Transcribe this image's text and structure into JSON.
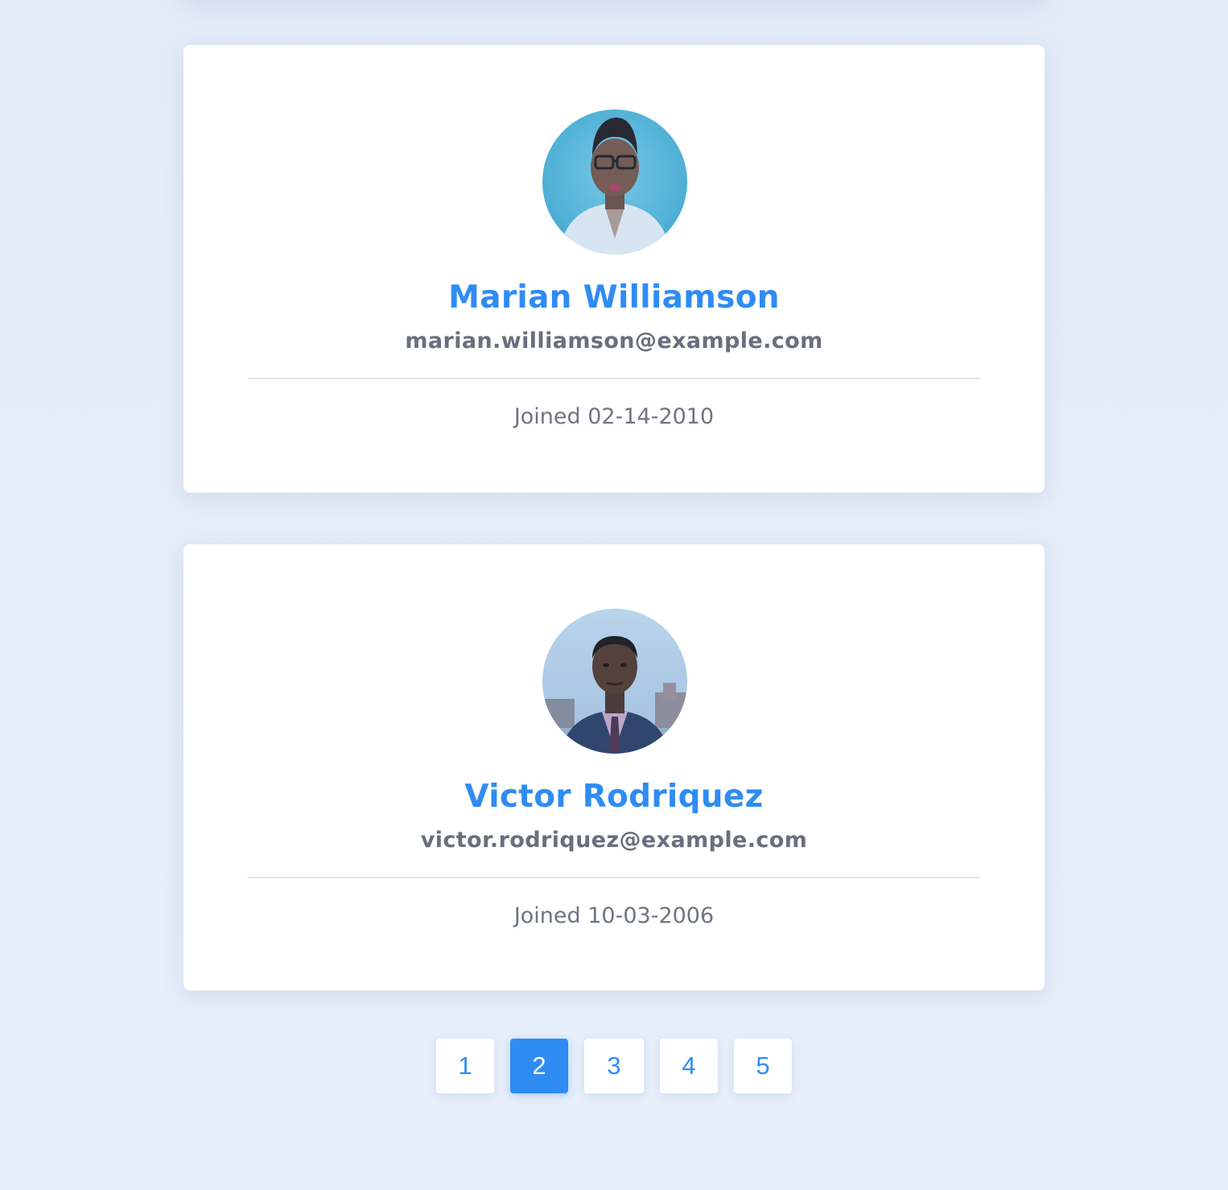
{
  "users": [
    {
      "name": "Marian Williamson",
      "email": "marian.williamson@example.com",
      "joined": "Joined 02-14-2010"
    },
    {
      "name": "Victor Rodriquez",
      "email": "victor.rodriquez@example.com",
      "joined": "Joined 10-03-2006"
    }
  ],
  "pagination": {
    "pages": [
      "1",
      "2",
      "3",
      "4",
      "5"
    ],
    "current": "2"
  },
  "colors": {
    "accent": "#2f8cf3",
    "text_muted": "#6a6f7c",
    "background": "#e4ecf8",
    "card": "#ffffff"
  }
}
